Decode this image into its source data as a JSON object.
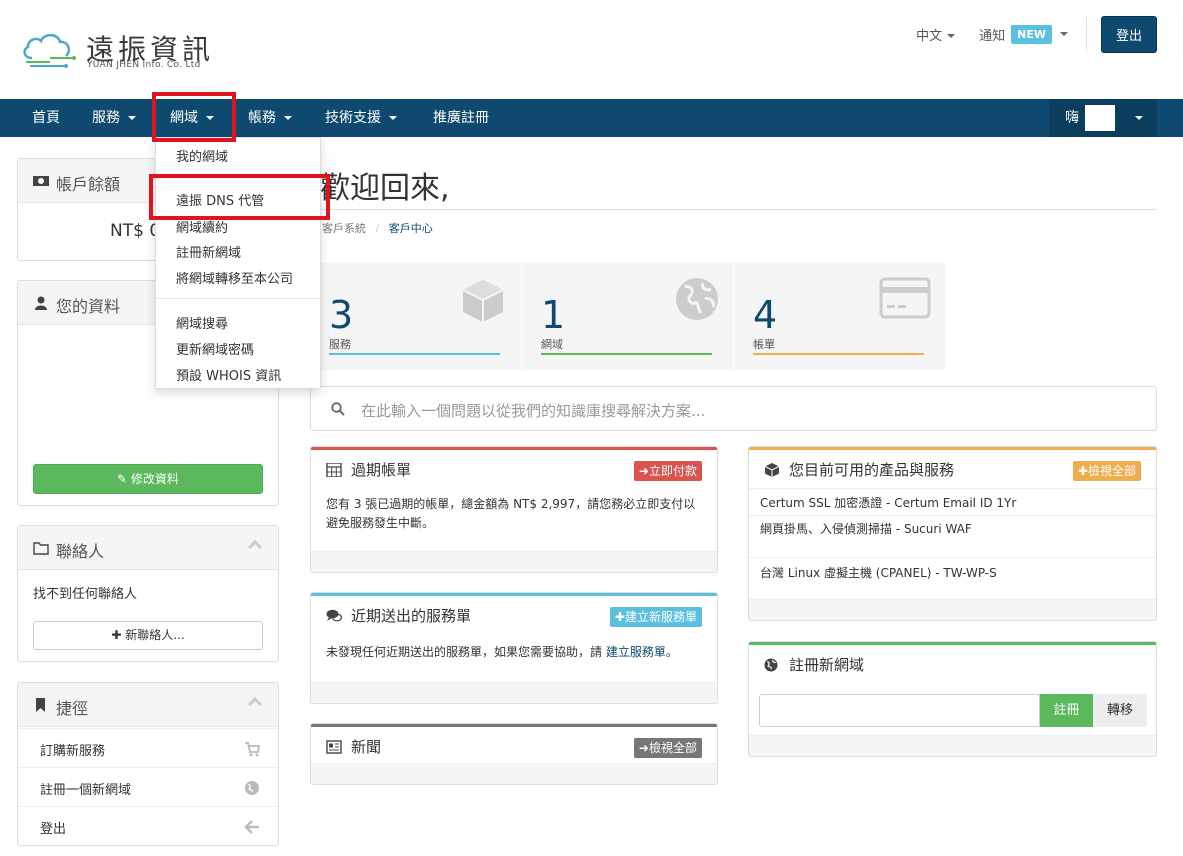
{
  "header": {
    "logo_cn": "遠振資訊",
    "logo_en": "YUAN JHEN Info. Co. Ltd",
    "language": "中文",
    "notify_label": "通知",
    "notify_badge": "NEW",
    "logout_label": "登出"
  },
  "nav": {
    "items": [
      {
        "label": "首頁"
      },
      {
        "label": "服務"
      },
      {
        "label": "網域"
      },
      {
        "label": "帳務"
      },
      {
        "label": "技術支援"
      },
      {
        "label": "推廣註冊"
      }
    ],
    "user_greeting": "嗨"
  },
  "domain_menu": {
    "items": [
      "我的網域",
      "遠振 DNS 代管",
      "網域續約",
      "註冊新網域",
      "將網域轉移至本公司",
      "網域搜尋",
      "更新網域密碼",
      "預設 WHOIS 資訊"
    ]
  },
  "sidebar": {
    "balance": {
      "title": "帳戶餘額",
      "value": "NT$ 0"
    },
    "profile": {
      "title": "您的資料",
      "edit_button": "修改資料"
    },
    "contacts": {
      "title": "聯絡人",
      "empty_text": "找不到任何聯絡人",
      "new_button": "新聯絡人..."
    },
    "shortcuts": {
      "title": "捷徑",
      "items": [
        {
          "label": "訂購新服務",
          "icon": "cart-icon"
        },
        {
          "label": "註冊一個新網域",
          "icon": "globe-icon"
        },
        {
          "label": "登出",
          "icon": "arrow-left-icon"
        }
      ]
    }
  },
  "main": {
    "welcome": "歡迎回來,",
    "breadcrumb": [
      "客戶系統",
      "客戶中心"
    ],
    "tiles": [
      {
        "count": "3",
        "label": "服務",
        "color": "#5bc0de",
        "icon": "cube-icon"
      },
      {
        "count": "1",
        "label": "網域",
        "color": "#5cb85c",
        "icon": "globe-icon"
      },
      {
        "count": "4",
        "label": "帳單",
        "color": "#f0ad4e",
        "icon": "credit-card-icon"
      }
    ],
    "search_placeholder": "在此輸入一個問題以從我們的知識庫搜尋解決方案...",
    "overdue": {
      "title": "過期帳單",
      "button": "立即付款",
      "body": "您有 3 張已過期的帳單，總金額為 NT$ 2,997，請您務必立即支付以避免服務發生中斷。",
      "color": "#d9534f"
    },
    "tickets": {
      "title": "近期送出的服務單",
      "button": "建立新服務單",
      "body_prefix": "未發現任何近期送出的服務單，如果您需要協助，請 ",
      "body_link": "建立服務單",
      "body_suffix": "。",
      "color": "#5bc0de"
    },
    "news": {
      "title": "新聞",
      "button": "檢視全部",
      "color": "#777777"
    },
    "services": {
      "title": "您目前可用的產品與服務",
      "button": "檢視全部",
      "color": "#f0ad4e",
      "items": [
        "Certum SSL 加密憑證 - Certum Email ID 1Yr",
        "網頁掛馬、入侵偵測掃描 - Sucuri WAF",
        "台灣 Linux 虛擬主機 (CPANEL) - TW-WP-S"
      ]
    },
    "register": {
      "title": "註冊新網域",
      "register_button": "註冊",
      "transfer_button": "轉移",
      "color": "#5cb85c"
    }
  }
}
